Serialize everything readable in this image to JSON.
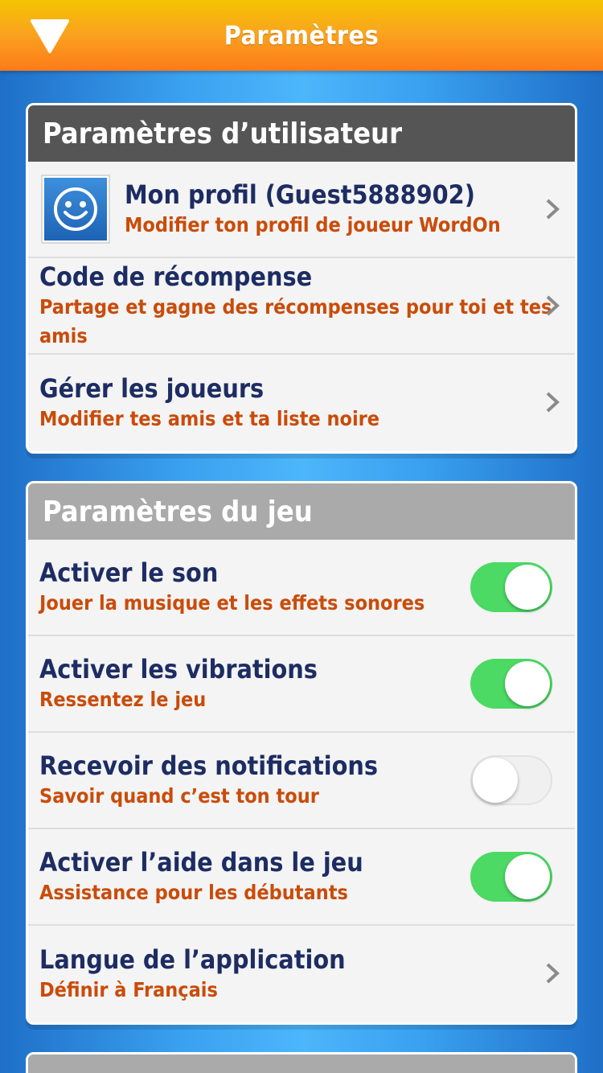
{
  "header": {
    "title": "Paramètres",
    "back_icon": "chevron-down-triangle-icon"
  },
  "user_settings": {
    "title": "Paramètres d’utilisateur",
    "items": [
      {
        "label": "Mon profil (Guest5888902)",
        "sub": "Modifier ton profil de joueur WordOn",
        "icon": "smiley-avatar-icon"
      },
      {
        "label": "Code de récompense",
        "sub": "Partage et gagne des récompenses pour toi et tes amis"
      },
      {
        "label": "Gérer les joueurs",
        "sub": "Modifier tes amis et ta liste noire"
      }
    ]
  },
  "game_settings": {
    "title": "Paramètres du jeu",
    "items": [
      {
        "label": "Activer le son",
        "sub": "Jouer la musique et les effets sonores",
        "toggle": true
      },
      {
        "label": "Activer les vibrations",
        "sub": "Ressentez le jeu",
        "toggle": true
      },
      {
        "label": "Recevoir des notifications",
        "sub": "Savoir quand c’est ton tour",
        "toggle": false
      },
      {
        "label": "Activer l’aide dans le jeu",
        "sub": "Assistance pour les débutants",
        "toggle": true
      },
      {
        "label": "Langue de l’application",
        "sub": "Définir à Français"
      }
    ]
  },
  "colors": {
    "toggle_on": "#4cd964",
    "primary_text": "#1d2d63",
    "secondary_text": "#c94c0a"
  }
}
